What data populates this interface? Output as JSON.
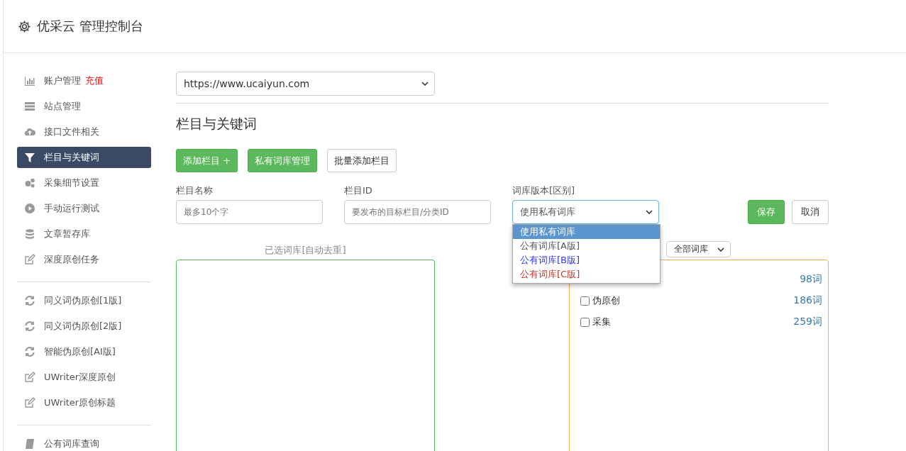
{
  "header": {
    "title": "优采云 管理控制台"
  },
  "sidebar": {
    "sections": [
      [
        {
          "label": "账户管理",
          "badge": "充值",
          "selected": false
        },
        {
          "label": "站点管理",
          "selected": false
        },
        {
          "label": "接口文件相关",
          "selected": false
        },
        {
          "label": "栏目与关键词",
          "selected": true
        },
        {
          "label": "采集细节设置",
          "selected": false
        },
        {
          "label": "手动运行测试",
          "selected": false
        },
        {
          "label": "文章暂存库",
          "selected": false
        },
        {
          "label": "深度原创任务",
          "selected": false
        }
      ],
      [
        {
          "label": "同义词伪原创[1版]",
          "selected": false
        },
        {
          "label": "同义词伪原创[2版]",
          "selected": false
        },
        {
          "label": "智能伪原创[AI版]",
          "selected": false
        },
        {
          "label": "UWriter深度原创",
          "selected": false
        },
        {
          "label": "UWriter原创标题",
          "selected": false
        }
      ],
      [
        {
          "label": "公有词库查询",
          "selected": false
        }
      ]
    ]
  },
  "site_select": {
    "value": "https://www.ucaiyun.com"
  },
  "section_title": "栏目与关键词",
  "actions": [
    {
      "label": "添加栏目 +",
      "kind": "primary"
    },
    {
      "label": "私有词库管理",
      "kind": "primary"
    },
    {
      "label": "批量添加栏目",
      "kind": "default"
    }
  ],
  "form": {
    "name_label": "栏目名称",
    "name_placeholder": "最多10个字",
    "id_label": "栏目ID",
    "id_placeholder": "要发布的目标栏目/分类ID",
    "version_label": "词库版本[区别]",
    "version_value": "使用私有词库",
    "version_options": [
      {
        "label": "使用私有词库",
        "selected": true
      },
      {
        "label": "公有词库[A版]",
        "selected": false
      },
      {
        "label": "公有词库[B版]",
        "selected": false,
        "color": "#3333ff"
      },
      {
        "label": "公有词库[C版]",
        "selected": false,
        "color": "#c0392b"
      }
    ],
    "save": "保存",
    "cancel": "取消"
  },
  "selected_label": "已选词库[自动去重]",
  "filter_select": {
    "value": "全部词库"
  },
  "library_rows": [
    {
      "count": "98词"
    },
    {
      "label": "伪原创",
      "count": "186词",
      "checked": false
    },
    {
      "label": "采集",
      "count": "259词",
      "checked": false
    }
  ]
}
